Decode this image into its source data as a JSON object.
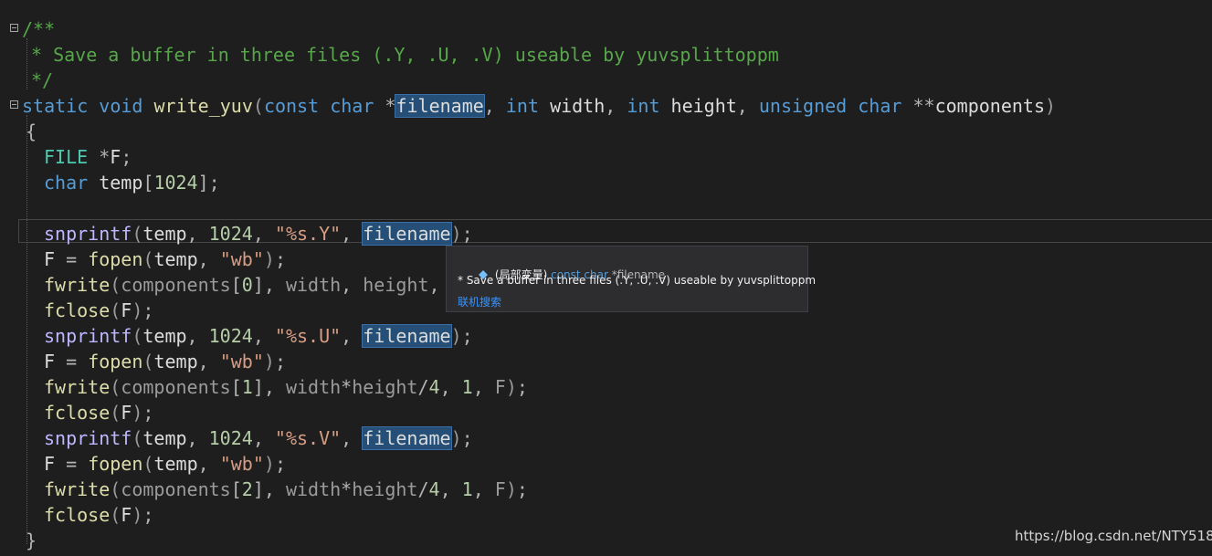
{
  "code_lines": [
    "/**",
    "* Save a buffer in three files (.Y, .U, .V) useable by yuvsplittoppm",
    "*/",
    "static void write_yuv(const char *filename, int width, int height, unsigned char **components)",
    "{",
    "FILE *F;",
    "char temp[1024];",
    "",
    "snprintf(temp, 1024, \"%s.Y\", filename);",
    "F = fopen(temp, \"wb\");",
    "fwrite(components[0], width, height,",
    "fclose(F);",
    "snprintf(temp, 1024, \"%s.U\", filename);",
    "F = fopen(temp, \"wb\");",
    "fwrite(components[1], width*height/4, 1, F);",
    "fclose(F);",
    "snprintf(temp, 1024, \"%s.V\", filename);",
    "F = fopen(temp, \"wb\");",
    "fwrite(components[2], width*height/4, 1, F);",
    "fclose(F);",
    "}"
  ],
  "tooltip": {
    "scope": "(局部变量)",
    "type": "const char",
    "name": "*filename",
    "description": "* Save a buffer in three files (.Y, .U, .V) useable by yuvsplittoppm",
    "link": "联机搜索",
    "icon": "local-variable-icon"
  },
  "watermark": "https://blog.csdn.net/NTY518",
  "colors": {
    "background": "#1e1e1e",
    "comment": "#57a64a",
    "keyword": "#569cd6",
    "function": "#dcdcaa",
    "string": "#d69d85",
    "number": "#b5cea8",
    "type": "#4ec9b0",
    "highlight": "#264f78"
  }
}
